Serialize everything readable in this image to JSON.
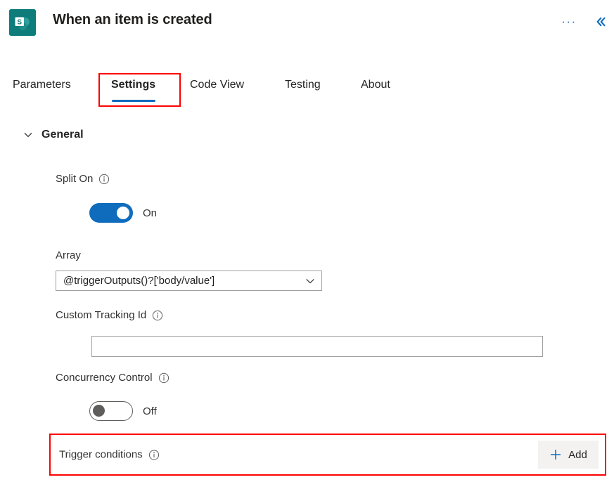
{
  "header": {
    "title": "When an item is created",
    "app_icon": "sharepoint-icon",
    "more_options_label": "···",
    "collapse_label": "«"
  },
  "tabs": [
    {
      "label": "Parameters",
      "active": false
    },
    {
      "label": "Settings",
      "active": true
    },
    {
      "label": "Code View",
      "active": false
    },
    {
      "label": "Testing",
      "active": false
    },
    {
      "label": "About",
      "active": false
    }
  ],
  "section": {
    "general_label": "General",
    "expanded": true
  },
  "fields": {
    "split_on": {
      "label": "Split On",
      "toggle_state": "On"
    },
    "array": {
      "label": "Array",
      "value": "@triggerOutputs()?['body/value']"
    },
    "custom_tracking_id": {
      "label": "Custom Tracking Id",
      "value": "",
      "placeholder": ""
    },
    "concurrency_control": {
      "label": "Concurrency Control",
      "toggle_state": "Off"
    },
    "trigger_conditions": {
      "label": "Trigger conditions",
      "add_label": "Add"
    }
  },
  "colors": {
    "accent_blue": "#0f6cbd",
    "annotation_red": "#ff0000",
    "sharepoint_teal": "#0e7c7b",
    "button_bg": "#f3f2f1"
  }
}
